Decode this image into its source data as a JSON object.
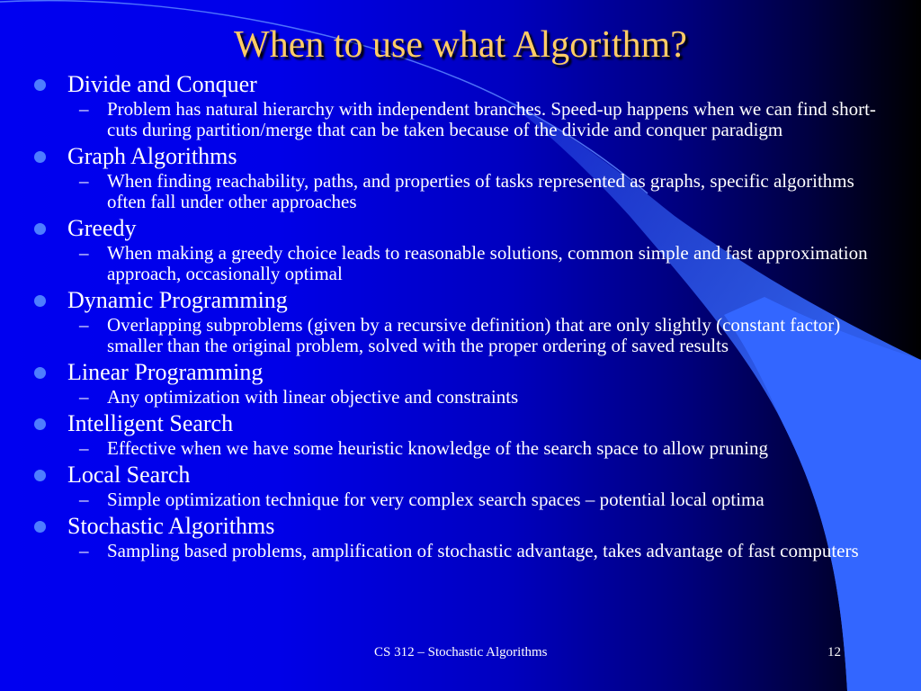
{
  "slide": {
    "title": "When to use what Algorithm?",
    "colors": {
      "title": "#ffcc66",
      "text": "#ffffff",
      "bullet": "#4d7dff",
      "arc": "#3366ff",
      "background_left": "#0000f0",
      "background_right": "#000000"
    },
    "bullet_icon": "filled-circle",
    "sub_bullet_icon": "en-dash",
    "items": [
      {
        "heading": "Divide and Conquer",
        "detail": "Problem has natural hierarchy with independent branches. Speed-up happens when we can find short-cuts during partition/merge that can be taken because of the divide and conquer paradigm"
      },
      {
        "heading": "Graph Algorithms",
        "detail": "When finding reachability, paths, and properties of tasks represented as graphs, specific algorithms often fall under other approaches"
      },
      {
        "heading": "Greedy",
        "detail": "When making a greedy choice leads to reasonable solutions, common simple and fast approximation approach, occasionally optimal"
      },
      {
        "heading": "Dynamic Programming",
        "detail": "Overlapping subproblems (given by a recursive definition) that are only slightly (constant factor) smaller than the original problem, solved with the proper ordering of saved results"
      },
      {
        "heading": "Linear Programming",
        "detail": "Any optimization with linear objective and constraints"
      },
      {
        "heading": "Intelligent Search",
        "detail": "Effective when we have some heuristic knowledge of the search space to allow pruning"
      },
      {
        "heading": "Local Search",
        "detail": "Simple optimization technique for very complex search spaces – potential local optima"
      },
      {
        "heading": "Stochastic Algorithms",
        "detail": "Sampling based problems, amplification of stochastic advantage, takes advantage of fast computers"
      }
    ],
    "sub_dash": "–",
    "footer": "CS 312 – Stochastic Algorithms",
    "page_number": "12"
  }
}
